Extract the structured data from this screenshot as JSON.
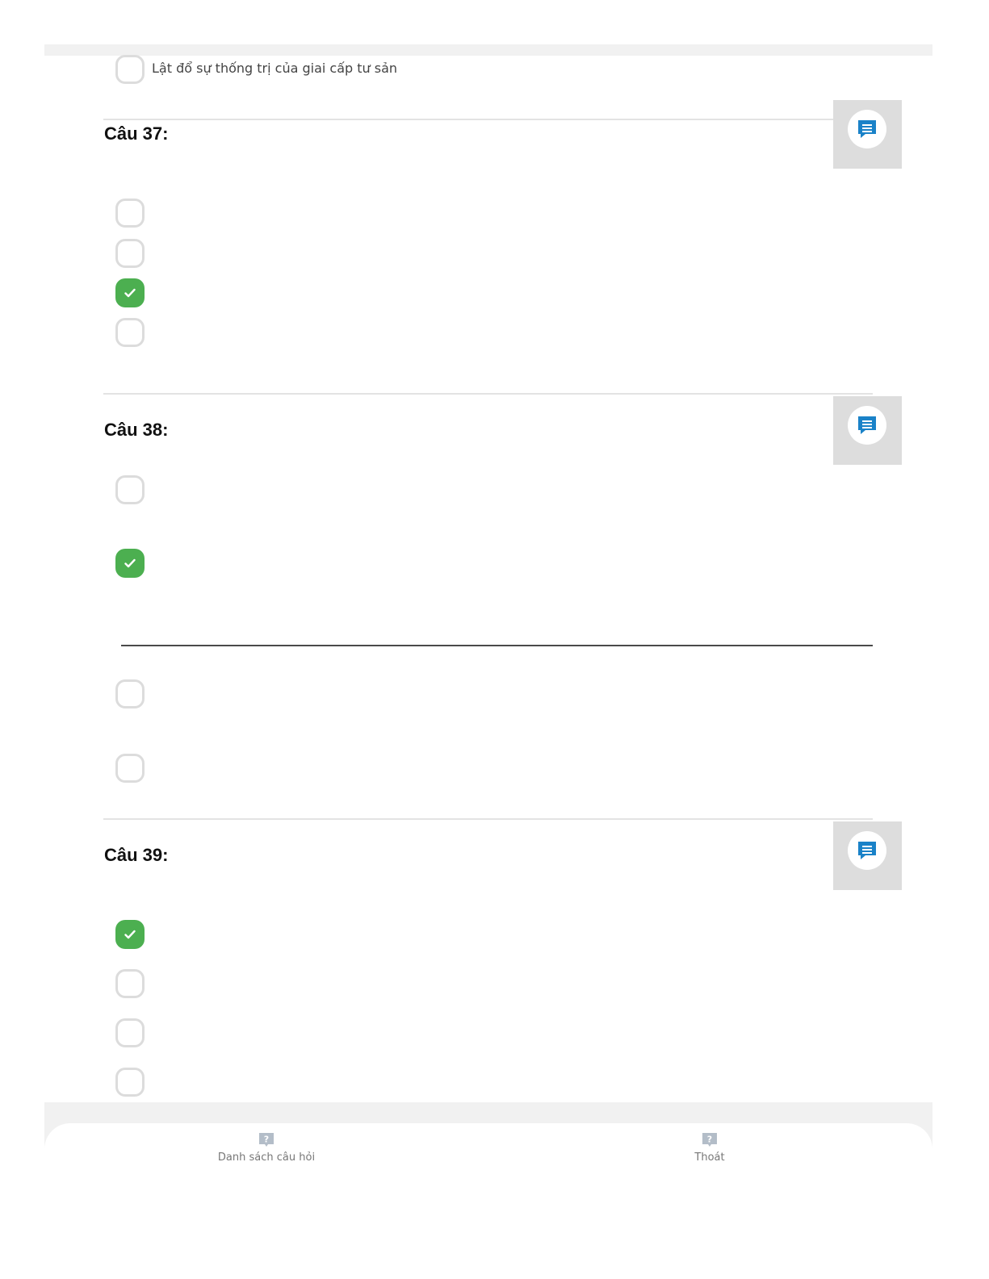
{
  "colors": {
    "checked": "#4caf50",
    "comment_icon": "#1a82c8",
    "nav_icon": "#b3bdc8"
  },
  "top_option": {
    "text": "Lật đổ sự thống trị của giai cấp tư sản"
  },
  "questions": [
    {
      "title": "Câu 37:",
      "options": [
        {
          "checked": false
        },
        {
          "checked": false
        },
        {
          "checked": true
        },
        {
          "checked": false
        }
      ]
    },
    {
      "title": "Câu 38:",
      "options": [
        {
          "checked": false
        },
        {
          "checked": true
        },
        {
          "checked": false
        },
        {
          "checked": false
        }
      ]
    },
    {
      "title": "Câu 39:",
      "options": [
        {
          "checked": true
        },
        {
          "checked": false
        },
        {
          "checked": false
        },
        {
          "checked": false
        }
      ]
    }
  ],
  "bottom_nav": {
    "question_list": {
      "label": "Danh sách câu hỏi",
      "icon": "question-icon"
    },
    "exit": {
      "label": "Thoát",
      "icon": "question-icon"
    }
  }
}
